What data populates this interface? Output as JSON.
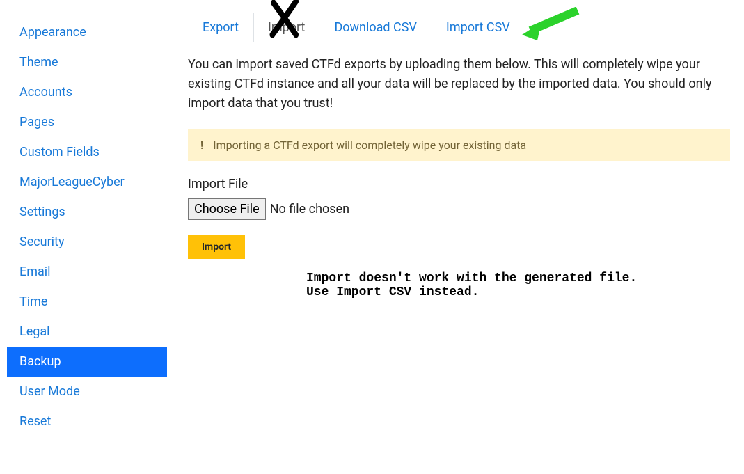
{
  "sidebar": {
    "items": [
      {
        "label": "Appearance",
        "active": false
      },
      {
        "label": "Theme",
        "active": false
      },
      {
        "label": "Accounts",
        "active": false
      },
      {
        "label": "Pages",
        "active": false
      },
      {
        "label": "Custom Fields",
        "active": false
      },
      {
        "label": "MajorLeagueCyber",
        "active": false
      },
      {
        "label": "Settings",
        "active": false
      },
      {
        "label": "Security",
        "active": false
      },
      {
        "label": "Email",
        "active": false
      },
      {
        "label": "Time",
        "active": false
      },
      {
        "label": "Legal",
        "active": false
      },
      {
        "label": "Backup",
        "active": true
      },
      {
        "label": "User Mode",
        "active": false
      },
      {
        "label": "Reset",
        "active": false
      }
    ]
  },
  "tabs": [
    {
      "label": "Export",
      "active": false
    },
    {
      "label": "Import",
      "active": true
    },
    {
      "label": "Download CSV",
      "active": false
    },
    {
      "label": "Import CSV",
      "active": false
    }
  ],
  "content": {
    "description": "You can import saved CTFd exports by uploading them below. This will completely wipe your existing CTFd instance and all your data will be replaced by the imported data. You should only import data that you trust!",
    "alert_icon": "!",
    "alert_text": "Importing a CTFd export will completely wipe your existing data",
    "form_label": "Import File",
    "file_button": "Choose File",
    "file_status": "No file chosen",
    "import_button": "Import"
  },
  "annotations": {
    "x_mark": "✗",
    "note_line1": "Import doesn't work with the generated file.",
    "note_line2": "Use Import CSV instead."
  }
}
